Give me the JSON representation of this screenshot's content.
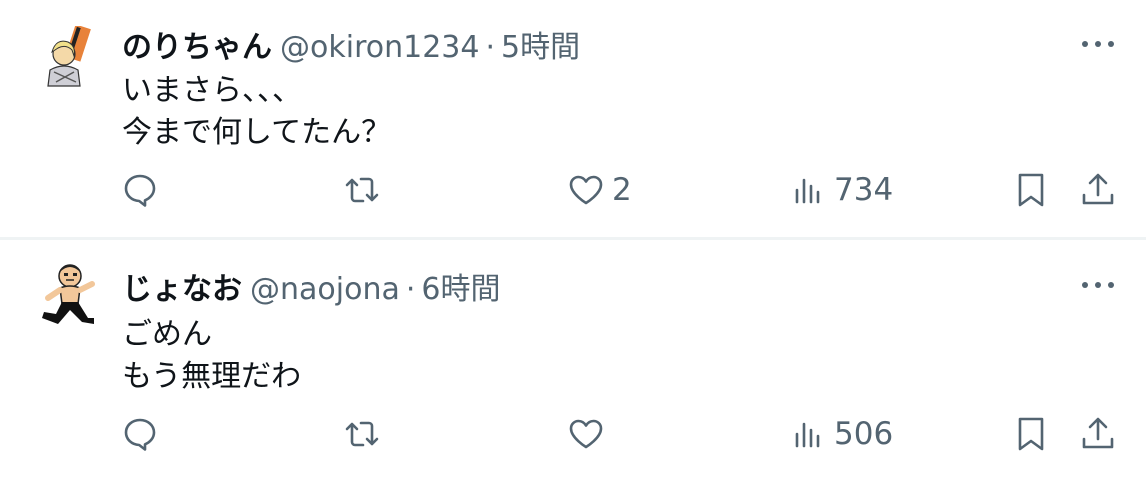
{
  "tweets": [
    {
      "display_name": "のりちゃん",
      "handle": "@okiron1234",
      "separator": "·",
      "time": "5時間",
      "lines": [
        "いまさら、、、",
        "今まで何してたん？"
      ],
      "like_count": "2",
      "view_count": "734"
    },
    {
      "display_name": "じょなお",
      "handle": "@naojona",
      "separator": "·",
      "time": "6時間",
      "lines": [
        "ごめん",
        "もう無理だわ"
      ],
      "like_count": "",
      "view_count": "506"
    }
  ],
  "icons": {
    "reply": "speech-bubble-icon",
    "retweet": "retweet-arrows-icon",
    "like": "heart-icon",
    "views": "bar-chart-icon",
    "bookmark": "bookmark-icon",
    "share": "share-upload-icon",
    "more": "more-horizontal-icon"
  },
  "colors": {
    "text_primary": "#0f1419",
    "text_secondary": "#536471",
    "divider": "#eff3f4",
    "avatar1_accent": "#e8823a"
  }
}
